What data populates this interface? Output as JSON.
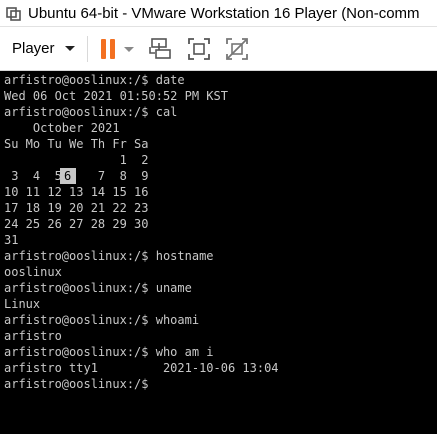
{
  "window": {
    "title": "Ubuntu 64-bit - VMware Workstation 16 Player (Non-comm",
    "app_icon": "vmware-icon"
  },
  "toolbar": {
    "player_label": "Player",
    "buttons": [
      {
        "name": "pause-icon",
        "color": "#f37021"
      },
      {
        "name": "send-ctrl-alt-del-icon"
      },
      {
        "name": "fit-guest-icon"
      },
      {
        "name": "unity-disabled-icon"
      }
    ]
  },
  "terminal": {
    "text_color": "#c8c8c8",
    "background": "#000000",
    "highlighted_day": "6",
    "lines": [
      "arfistro@ooslinux:/$ date",
      "Wed 06 Oct 2021 01:50:52 PM KST",
      "arfistro@ooslinux:/$ cal",
      "    October 2021",
      "Su Mo Tu We Th Fr Sa",
      "                1  2",
      " 3  4  5     7  8  9",
      "10 11 12 13 14 15 16",
      "17 18 19 20 21 22 23",
      "24 25 26 27 28 29 30",
      "31",
      "arfistro@ooslinux:/$ hostname",
      "ooslinux",
      "arfistro@ooslinux:/$ uname",
      "Linux",
      "arfistro@ooslinux:/$ whoami",
      "arfistro",
      "arfistro@ooslinux:/$ who am i",
      "arfistro tty1         2021-10-06 13:04",
      "arfistro@ooslinux:/$"
    ]
  }
}
